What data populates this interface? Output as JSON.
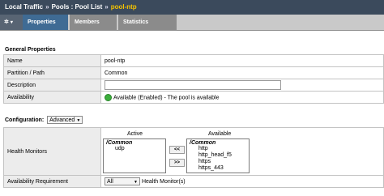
{
  "breadcrumb": {
    "root": "Local Traffic",
    "sep1": "»",
    "pools": "Pools : Pool List",
    "sep2": "»",
    "current": "pool-ntp"
  },
  "tabs": {
    "gear": "✲",
    "gear_arrow": "▾",
    "properties": "Properties",
    "members": "Members",
    "statistics": "Statistics"
  },
  "general": {
    "title": "General Properties",
    "rows": [
      {
        "label": "Name",
        "value": "pool-ntp"
      },
      {
        "label": "Partition / Path",
        "value": "Common"
      },
      {
        "label": "Description",
        "value": ""
      },
      {
        "label": "Availability",
        "value": "Available (Enabled) - The pool is available"
      }
    ]
  },
  "configuration": {
    "label": "Configuration:",
    "mode": "Advanced",
    "health_monitors": {
      "label": "Health Monitors",
      "active_header": "Active",
      "available_header": "Available",
      "active_group": "/Common",
      "active_items": [
        "udp"
      ],
      "available_group": "/Common",
      "available_items": [
        "http",
        "http_head_f5",
        "https",
        "https_443"
      ],
      "add_label": "<<",
      "remove_label": ">>"
    },
    "availability_requirement": {
      "label": "Availability Requirement",
      "select": "All",
      "suffix": "Health Monitor(s)"
    }
  },
  "colors": {
    "titlebar": "#3b4a5c",
    "current": "#f5c400",
    "active_tab": "#3f6b94",
    "status_green": "#3cae3c"
  }
}
